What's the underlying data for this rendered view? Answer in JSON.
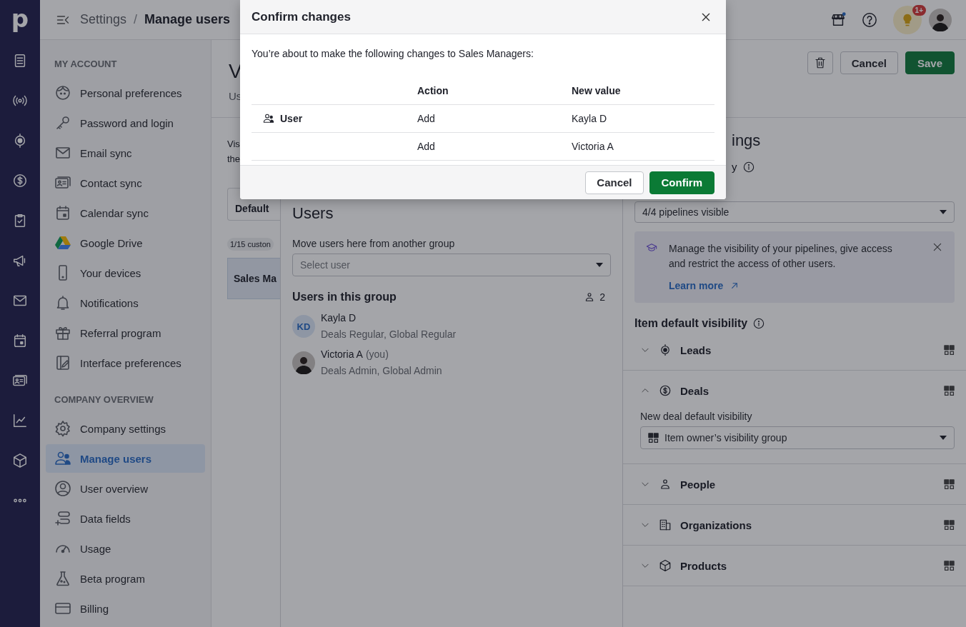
{
  "logo": "p",
  "header": {
    "breadcrumb_parent": "Settings",
    "breadcrumb_separator": "/",
    "breadcrumb_current": "Manage users",
    "notification_badge": "1+"
  },
  "settings_nav": [
    {
      "title": "MY ACCOUNT",
      "items": [
        {
          "label": "Personal preferences",
          "selected": false
        },
        {
          "label": "Password and login",
          "selected": false
        },
        {
          "label": "Email sync",
          "selected": false
        },
        {
          "label": "Contact sync",
          "selected": false
        },
        {
          "label": "Calendar sync",
          "selected": false
        },
        {
          "label": "Google Drive",
          "selected": false
        },
        {
          "label": "Your devices",
          "selected": false
        },
        {
          "label": "Notifications",
          "selected": false
        },
        {
          "label": "Referral program",
          "selected": false
        },
        {
          "label": "Interface preferences",
          "selected": false
        }
      ]
    },
    {
      "title": "COMPANY OVERVIEW",
      "items": [
        {
          "label": "Company settings",
          "selected": false
        },
        {
          "label": "Manage users",
          "selected": true
        },
        {
          "label": "User overview",
          "selected": false
        },
        {
          "label": "Data fields",
          "selected": false
        },
        {
          "label": "Usage",
          "selected": false
        },
        {
          "label": "Beta program",
          "selected": false
        },
        {
          "label": "Billing",
          "selected": false
        }
      ]
    }
  ],
  "page": {
    "title": "V",
    "tab": "Us",
    "buttons": {
      "cancel": "Cancel",
      "save": "Save"
    }
  },
  "left_column": {
    "intro_lines": [
      "Vis",
      "the"
    ],
    "default_card": "Default",
    "count_chip": "1/15 custon",
    "group_card": {
      "label": "Sales Ma",
      "selected": true
    }
  },
  "users_panel": {
    "title": "Users",
    "move_label": "Move users here from another group",
    "select_placeholder": "Select user",
    "group_heading": "Users in this group",
    "count": "2",
    "users": [
      {
        "kind": "initials",
        "initials": "KD",
        "name": "Kayla D",
        "roles": "Deals Regular, Global Regular"
      },
      {
        "kind": "photo",
        "name": "Victoria A",
        "suffix": "(you)",
        "roles": "Deals Admin, Global Admin"
      }
    ]
  },
  "visibility_panel": {
    "heading": "ings",
    "field_label": "y",
    "pipelines_select": "4/4 pipelines visible",
    "banner": {
      "text": "Manage the visibility of your pipelines, give access and restrict the access of other users.",
      "link": "Learn more"
    },
    "item_heading": "Item default visibility",
    "entities": [
      {
        "name": "Leads",
        "expanded": false
      },
      {
        "name": "Deals",
        "expanded": true,
        "field_label": "New deal default visibility",
        "value": "Item owner’s visibility group"
      },
      {
        "name": "People",
        "expanded": false
      },
      {
        "name": "Organizations",
        "expanded": false
      },
      {
        "name": "Products",
        "expanded": false
      }
    ]
  },
  "modal": {
    "title": "Confirm changes",
    "message": "You’re about to make the following changes to Sales Managers:",
    "columns": [
      "Action",
      "New value"
    ],
    "rows": [
      {
        "entity": "User",
        "action": "Add",
        "value": "Kayla D"
      },
      {
        "action": "Add",
        "value": "Victoria A"
      }
    ],
    "buttons": {
      "cancel": "Cancel",
      "confirm": "Confirm"
    }
  }
}
